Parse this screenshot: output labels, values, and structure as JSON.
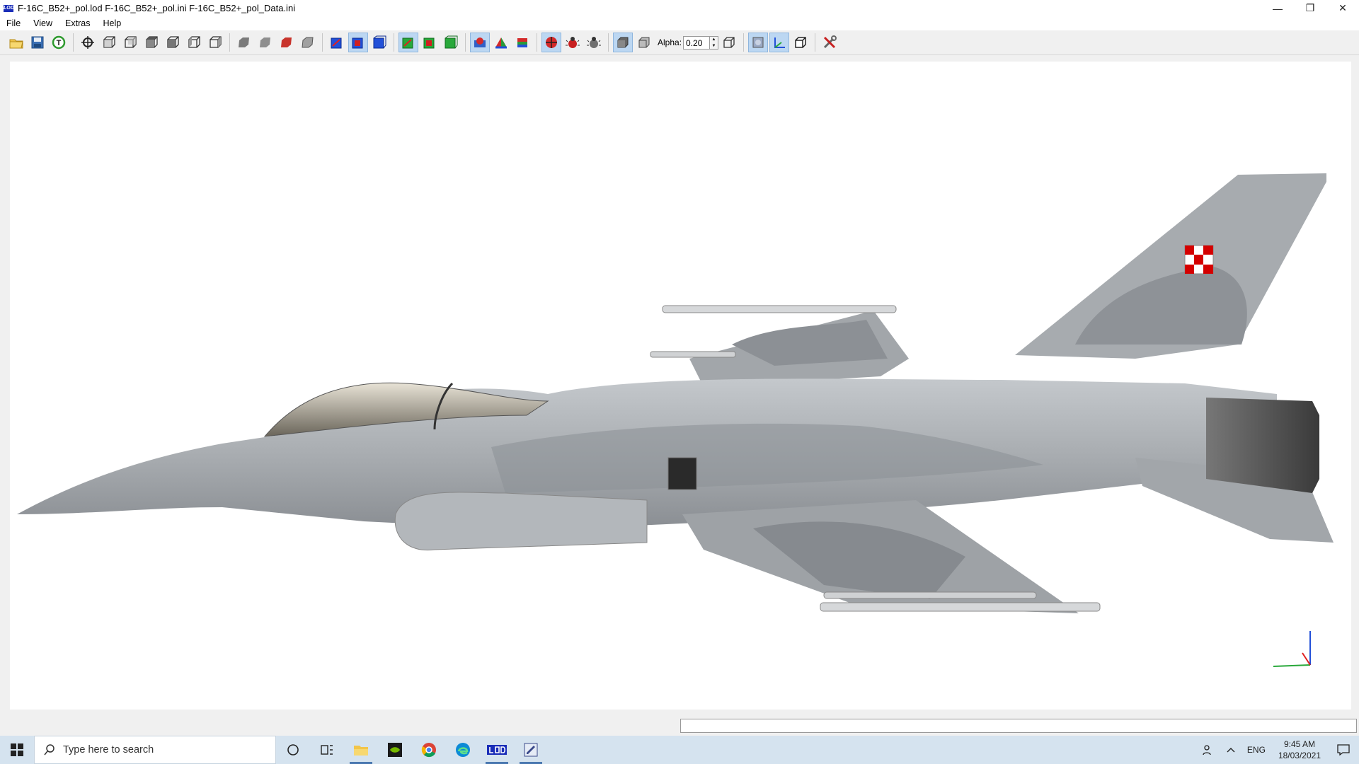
{
  "window": {
    "app_badge": "LOD",
    "title": "F-16C_B52+_pol.lod  F-16C_B52+_pol.ini  F-16C_B52+_pol_Data.ini",
    "minimize": "—",
    "restore": "❐",
    "close": "✕"
  },
  "menu": [
    {
      "label": "File"
    },
    {
      "label": "View"
    },
    {
      "label": "Extras"
    },
    {
      "label": "Help"
    }
  ],
  "toolbar": {
    "alpha_label": "Alpha:",
    "alpha_value": "0.20",
    "spin_up": "▲",
    "spin_down": "▼"
  },
  "colors": {
    "accent_active": "#bcd7f2",
    "taskbar": "#d5e3ef",
    "aircraft_grey": "#a9adb1",
    "aircraft_dark": "#8c9095",
    "roundel_red": "#d40000"
  },
  "taskbar": {
    "search_placeholder": "Type here to search",
    "language": "ENG",
    "time": "9:45 AM",
    "date": "18/03/2021",
    "apps": [
      "file-explorer-icon",
      "nvidia-icon",
      "chrome-icon",
      "edge-icon",
      "lod-viewer-icon",
      "editor-icon"
    ]
  }
}
